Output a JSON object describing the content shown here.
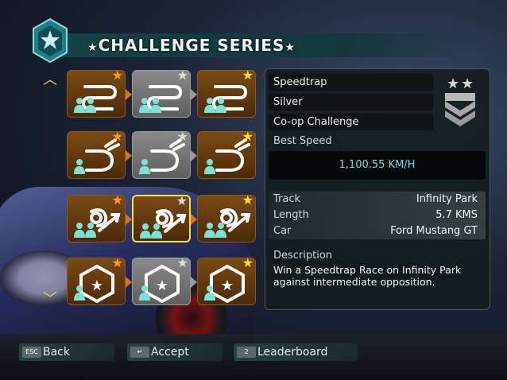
{
  "header": {
    "title": "CHALLENGE SERIES"
  },
  "grid": {
    "rows": [
      {
        "type": "speedtrap-circuit",
        "tiles": [
          {
            "state": "done",
            "star": "bronze",
            "people": 2
          },
          {
            "state": "mid",
            "star": "silver",
            "people": 2
          },
          {
            "state": "done",
            "star": "gold",
            "people": 2
          }
        ]
      },
      {
        "type": "drift",
        "tiles": [
          {
            "state": "done",
            "star": "bronze",
            "people": 1
          },
          {
            "state": "mid",
            "star": "silver",
            "people": 1
          },
          {
            "state": "done",
            "star": "gold",
            "people": 1
          }
        ]
      },
      {
        "type": "speedtrap",
        "tiles": [
          {
            "state": "done",
            "star": "bronze",
            "people": 2
          },
          {
            "state": "done",
            "star": "silver",
            "people": 2,
            "selected": true
          },
          {
            "state": "done",
            "star": "gold",
            "people": 2
          }
        ]
      },
      {
        "type": "pursuit",
        "tiles": [
          {
            "state": "done",
            "star": "bronze",
            "people": 1
          },
          {
            "state": "mid",
            "star": "silver",
            "people": 1
          },
          {
            "state": "done",
            "star": "gold",
            "people": 1
          }
        ]
      }
    ]
  },
  "details": {
    "event_name": "Speedtrap",
    "tier": "Silver",
    "mode": "Co-op Challenge",
    "best_speed_label": "Best Speed",
    "best_speed_value": "1,100.55 KM/H",
    "stats": [
      {
        "key": "Track",
        "value": "Infinity Park"
      },
      {
        "key": "Length",
        "value": "5.7 KMS"
      },
      {
        "key": "Car",
        "value": "Ford Mustang GT"
      }
    ],
    "description_label": "Description",
    "description": "Win a Speedtrap Race on Infinity Park against intermediate opposition."
  },
  "footer": {
    "back": {
      "key": "ESC",
      "label": "Back"
    },
    "accept": {
      "key": "↵",
      "label": "Accept"
    },
    "leaderboard": {
      "key": "2",
      "label": "Leaderboard"
    }
  },
  "colors": {
    "bronze_star": "#ff9a2a",
    "silver_star": "#dcdcdc",
    "gold_star": "#ffe02a",
    "speed_text": "#6fe1e8",
    "selection": "#f2e23a"
  }
}
